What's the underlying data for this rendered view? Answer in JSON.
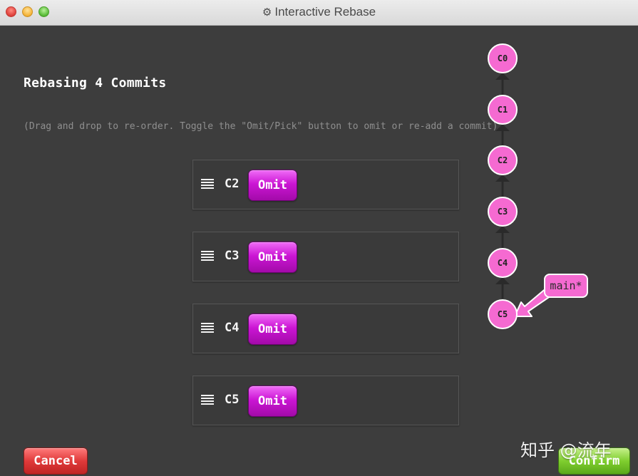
{
  "window": {
    "title": "Interactive Rebase",
    "title_icon": "gear-icon"
  },
  "dialog": {
    "title": "Rebasing 4 Commits",
    "instructions": "(Drag and drop to re-order. Toggle the \"Omit/Pick\" button to omit or re-add a commit)"
  },
  "commits": [
    {
      "id": "C2",
      "action_label": "Omit"
    },
    {
      "id": "C3",
      "action_label": "Omit"
    },
    {
      "id": "C4",
      "action_label": "Omit"
    },
    {
      "id": "C5",
      "action_label": "Omit"
    }
  ],
  "graph": {
    "nodes": [
      "C0",
      "C1",
      "C2",
      "C3",
      "C4",
      "C5"
    ],
    "branch": "main*",
    "node_color": "#f56ad1"
  },
  "footer": {
    "cancel_label": "Cancel",
    "confirm_label": "Confirm"
  },
  "watermark": "知乎 @流年"
}
